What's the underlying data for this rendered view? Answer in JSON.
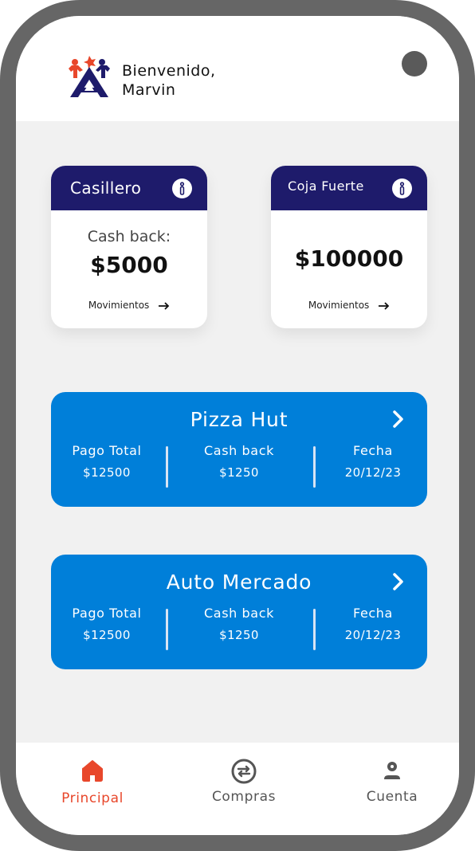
{
  "header": {
    "welcome_line1": "Bienvenido,",
    "welcome_line2": "Marvin"
  },
  "cards": [
    {
      "title": "Casillero",
      "subtitle": "Cash back:",
      "amount": "$5000",
      "link": "Movimientos"
    },
    {
      "title": "Coja Fuerte",
      "amount": "$100000",
      "link": "Movimientos"
    }
  ],
  "stores": [
    {
      "name": "Pizza Hut",
      "total_label": "Pago Total",
      "total_value": "$12500",
      "cashback_label": "Cash back",
      "cashback_value": "$1250",
      "date_label": "Fecha",
      "date_value": "20/12/23"
    },
    {
      "name": "Auto Mercado",
      "total_label": "Pago Total",
      "total_value": "$12500",
      "cashback_label": "Cash back",
      "cashback_value": "$1250",
      "date_label": "Fecha",
      "date_value": "20/12/23"
    }
  ],
  "nav": {
    "items": [
      {
        "label": "Principal",
        "icon": "home-icon",
        "active": true
      },
      {
        "label": "Compras",
        "icon": "exchange-icon",
        "active": false
      },
      {
        "label": "Cuenta",
        "icon": "user-icon",
        "active": false
      }
    ]
  },
  "colors": {
    "card_header": "#1e1b6b",
    "store_card": "#007fd9",
    "active_nav": "#e8472b",
    "inactive_nav": "#555555",
    "frame": "#666666",
    "background": "#f1f1f1"
  }
}
